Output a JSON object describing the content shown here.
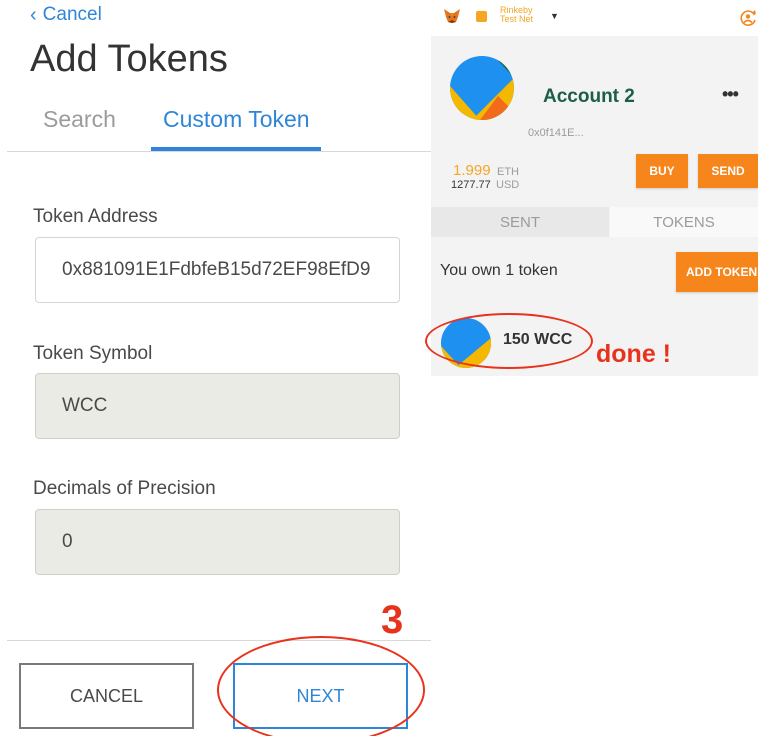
{
  "add_tokens": {
    "cancel_link": "Cancel",
    "title": "Add Tokens",
    "tabs": [
      {
        "label": "Search",
        "active": false
      },
      {
        "label": "Custom Token",
        "active": true
      }
    ],
    "fields": {
      "token_address": {
        "label": "Token Address",
        "value": "0x881091E1FdbfeB15d72EF98EfD9"
      },
      "token_symbol": {
        "label": "Token Symbol",
        "value": "WCC"
      },
      "decimals": {
        "label": "Decimals of Precision",
        "value": "0"
      }
    },
    "buttons": {
      "cancel": "CANCEL",
      "next": "NEXT"
    },
    "accent_color": "#2f86d8"
  },
  "annotations": {
    "step_number": "3",
    "done_text": "done !",
    "color": "#e8331c"
  },
  "metamask": {
    "network": {
      "line1": "Rinkeby",
      "line2": "Test Net",
      "color": "#f5a623"
    },
    "account": {
      "name": "Account 2",
      "address": "0x0f141E...",
      "eth_balance": "1.999",
      "eth_unit": "ETH",
      "usd_balance": "1277.77",
      "usd_unit": "USD"
    },
    "buttons": {
      "buy": "BUY",
      "send": "SEND",
      "add_token": "ADD TOKEN"
    },
    "tabs": [
      {
        "label": "SENT",
        "active": false
      },
      {
        "label": "TOKENS",
        "active": true
      }
    ],
    "token_count_text": "You own 1 token",
    "tokens": [
      {
        "amount_symbol": "150 WCC"
      }
    ],
    "brand_color": "#f6851b",
    "icons": [
      "metamask-fox-icon",
      "account-switch-icon",
      "more-dots-icon",
      "dropdown-caret-icon",
      "back-chevron-icon"
    ]
  }
}
